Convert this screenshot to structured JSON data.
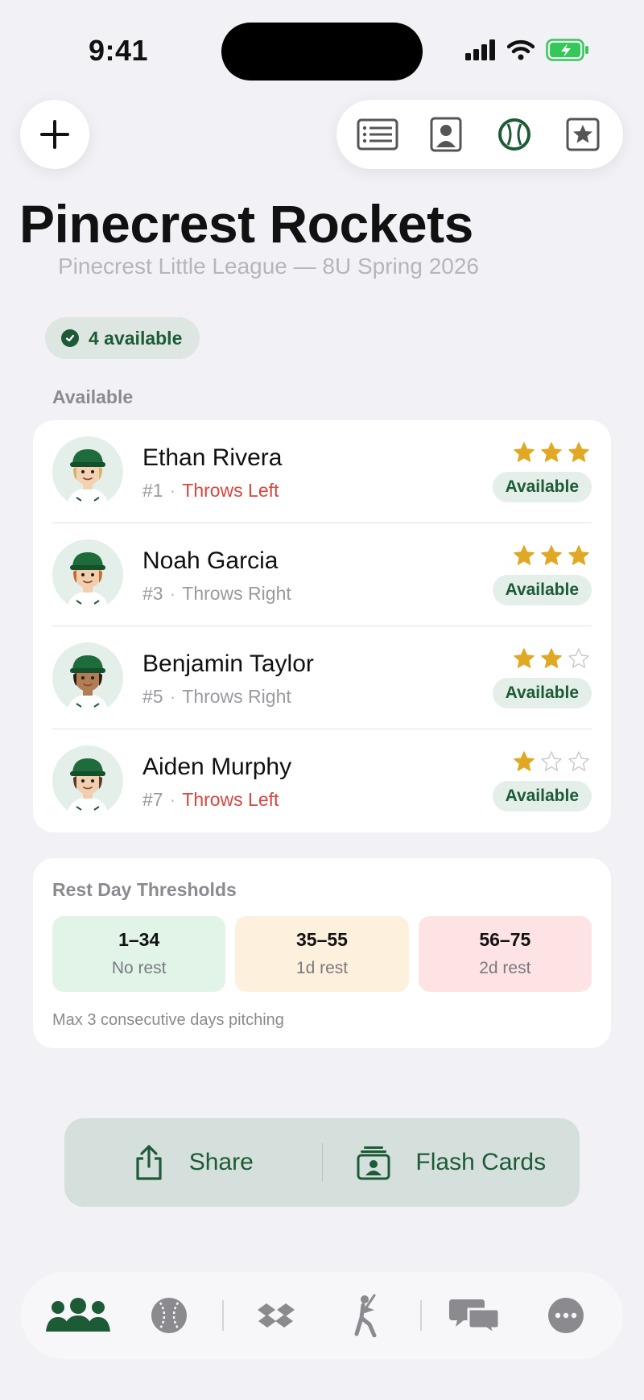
{
  "status_bar": {
    "time": "9:41"
  },
  "header": {
    "title": "Pinecrest Rockets",
    "subtitle": "Pinecrest Little League — 8U Spring 2026"
  },
  "availability_badge": "4 available",
  "section_label": "Available",
  "players": [
    {
      "name": "Ethan Rivera",
      "number": "#1",
      "throws": "Throws Left",
      "throws_left": true,
      "stars": 3,
      "status": "Available"
    },
    {
      "name": "Noah Garcia",
      "number": "#3",
      "throws": "Throws Right",
      "throws_left": false,
      "stars": 3,
      "status": "Available"
    },
    {
      "name": "Benjamin Taylor",
      "number": "#5",
      "throws": "Throws Right",
      "throws_left": false,
      "stars": 2,
      "status": "Available"
    },
    {
      "name": "Aiden Murphy",
      "number": "#7",
      "throws": "Throws Left",
      "throws_left": true,
      "stars": 1,
      "status": "Available"
    }
  ],
  "thresholds": {
    "title": "Rest Day Thresholds",
    "items": [
      {
        "range": "1–34",
        "rest": "No rest",
        "color": "#e1f4e7"
      },
      {
        "range": "35–55",
        "rest": "1d rest",
        "color": "#fdf0dc"
      },
      {
        "range": "56–75",
        "rest": "2d rest",
        "color": "#fde3e3"
      }
    ],
    "note": "Max 3 consecutive days pitching"
  },
  "actions": {
    "share": "Share",
    "flash_cards": "Flash Cards"
  },
  "colors": {
    "accent": "#1d5b37",
    "star": "#e0a823",
    "left_hand": "#d9453f"
  },
  "tabs": [
    "team-icon",
    "baseball-icon",
    "field-icon",
    "batter-icon",
    "chat-icon",
    "more-icon"
  ]
}
